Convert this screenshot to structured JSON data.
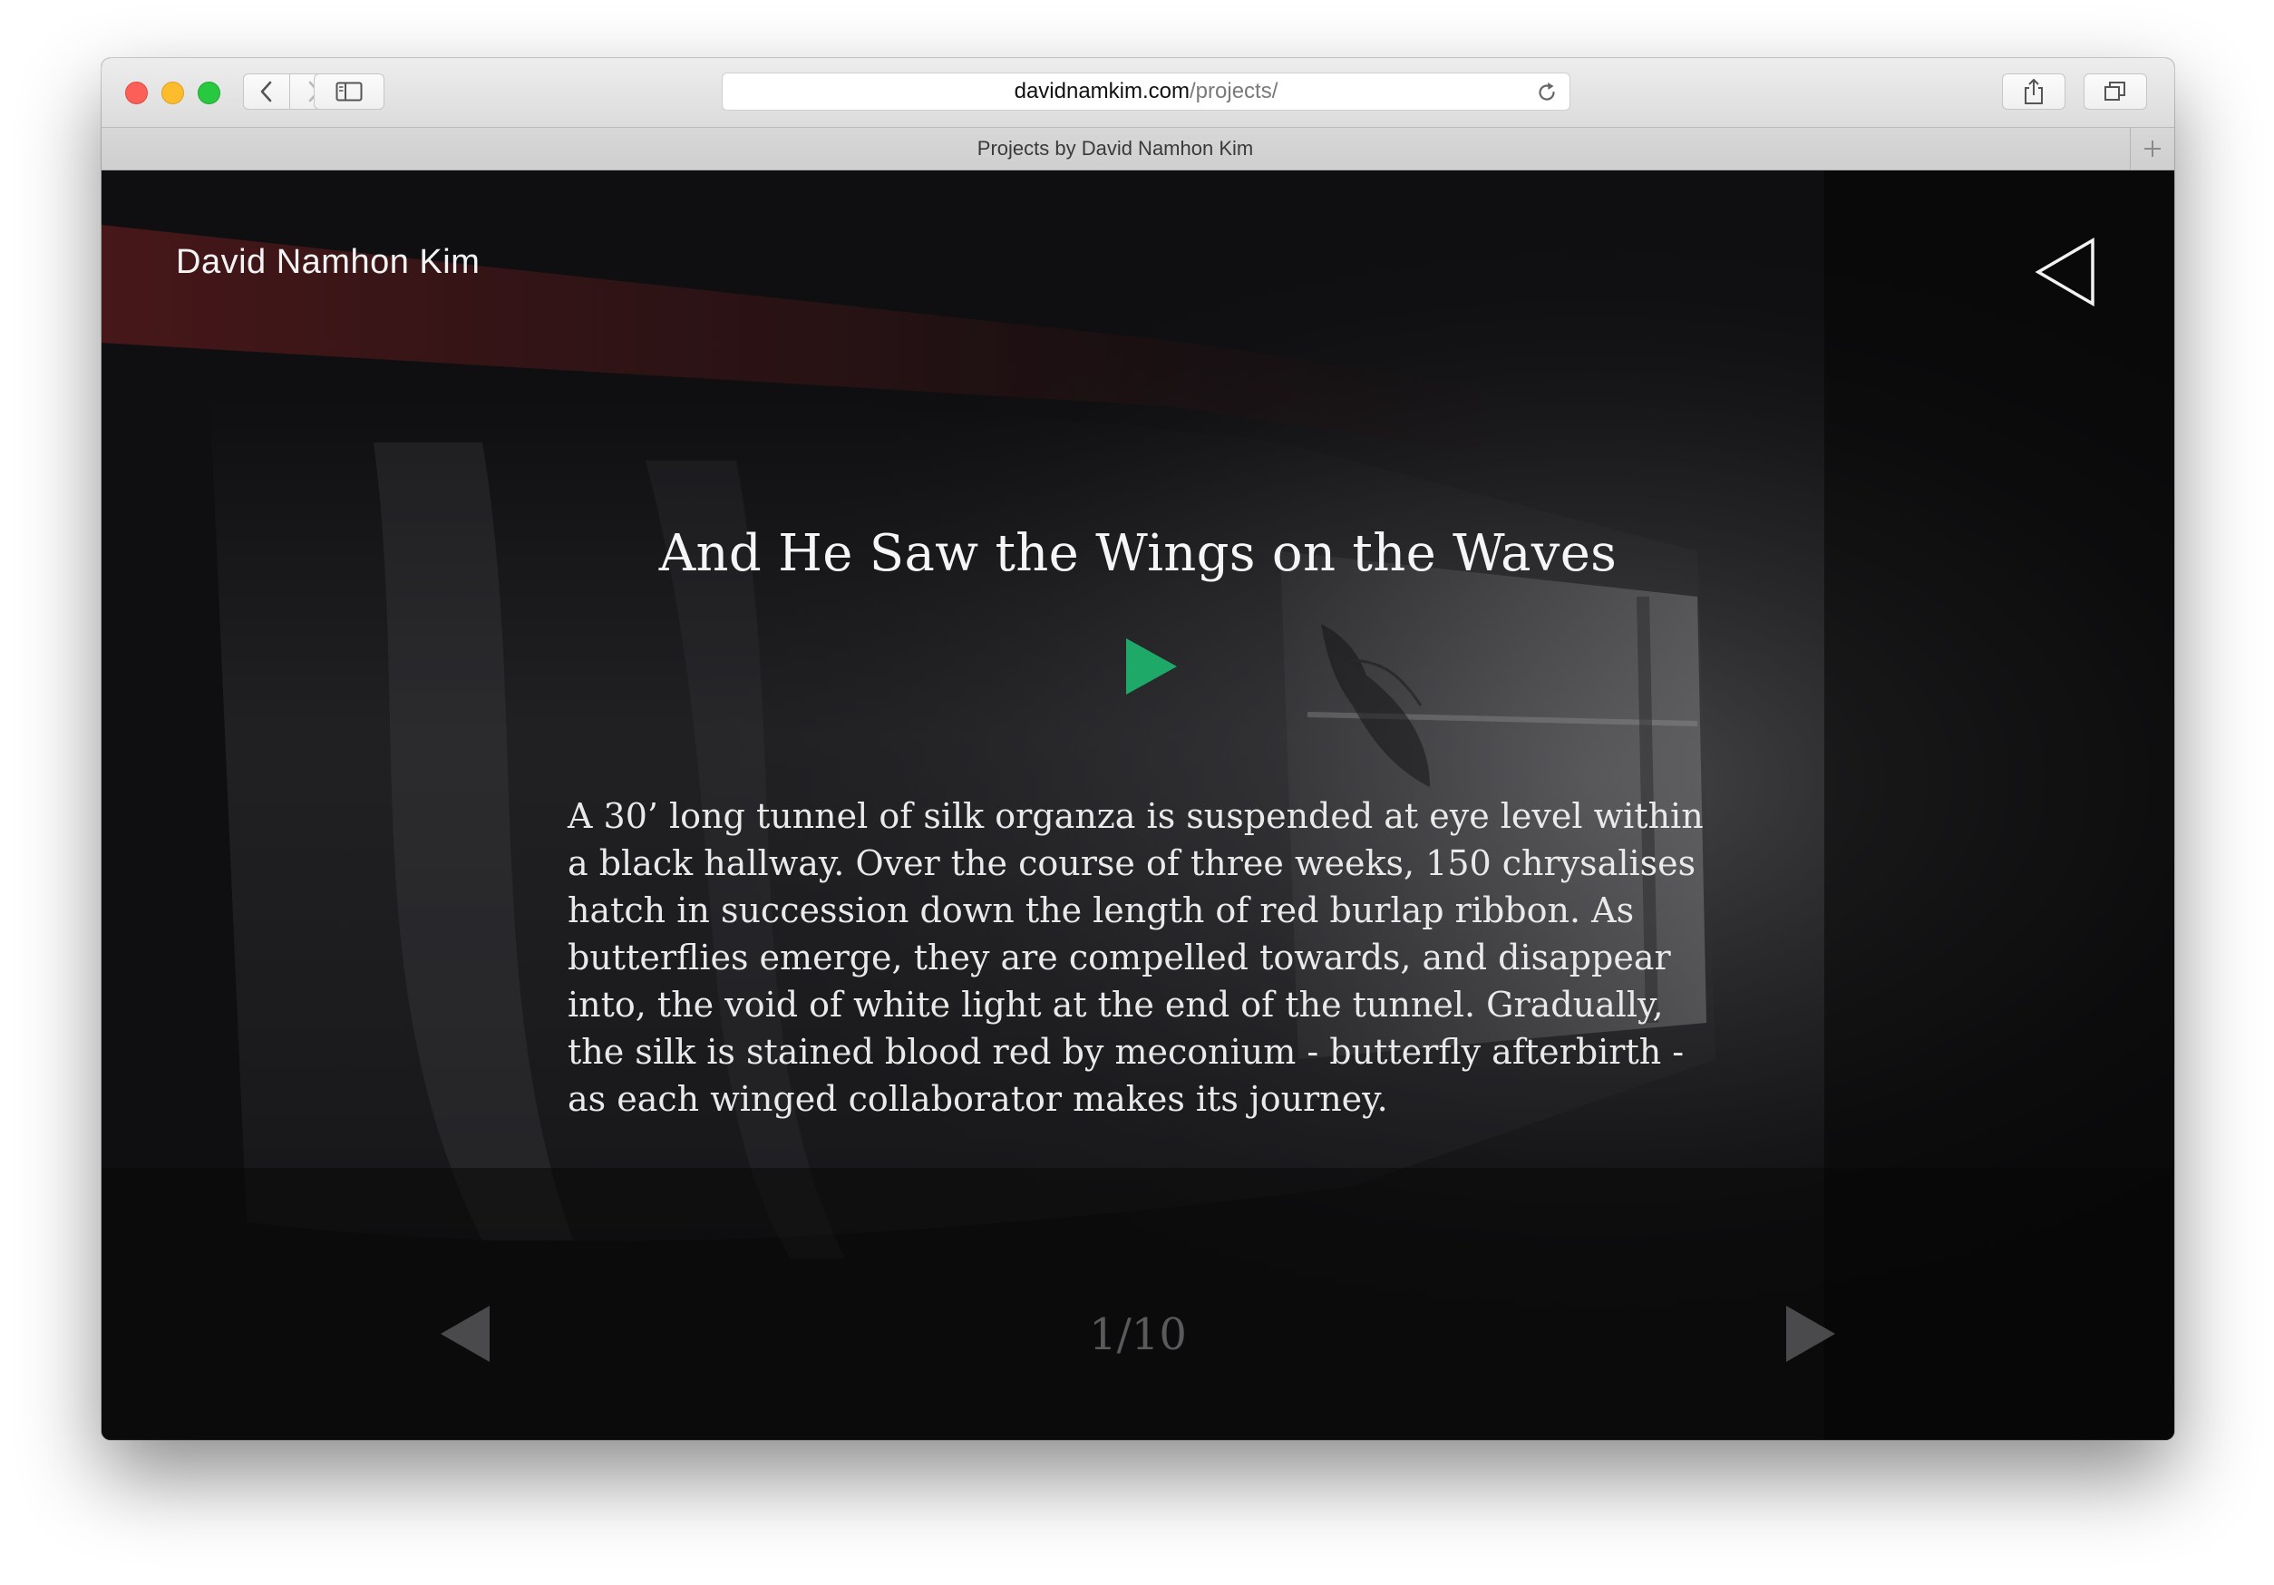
{
  "browser": {
    "url_host": "davidnamkim.com",
    "url_path": "/projects/",
    "tab_title": "Projects by David Namhon Kim"
  },
  "site": {
    "name": "David Namhon Kim"
  },
  "project": {
    "title": "And He Saw the Wings on the Waves",
    "description": "A 30’ long tunnel of silk organza is suspended at eye level within a black hallway. Over the course of three weeks, 150 chrysalises hatch in succession down the length of red burlap ribbon. As butterflies emerge, they are compelled towards, and disappear into, the void of white light at the end of the tunnel. Gradually, the silk is stained blood red by meconium - butterfly afterbirth - as each winged collaborator makes its journey.",
    "counter": "1/10"
  },
  "icons": {
    "menu": "triangle-left-outline-icon",
    "play": "play-icon",
    "prev": "prev-arrow-icon",
    "next": "next-arrow-icon"
  },
  "colors": {
    "play_green": "#1fa968",
    "background": "#0d0d0f",
    "text": "#f5f5f5",
    "counter": "#5a5a5c"
  }
}
